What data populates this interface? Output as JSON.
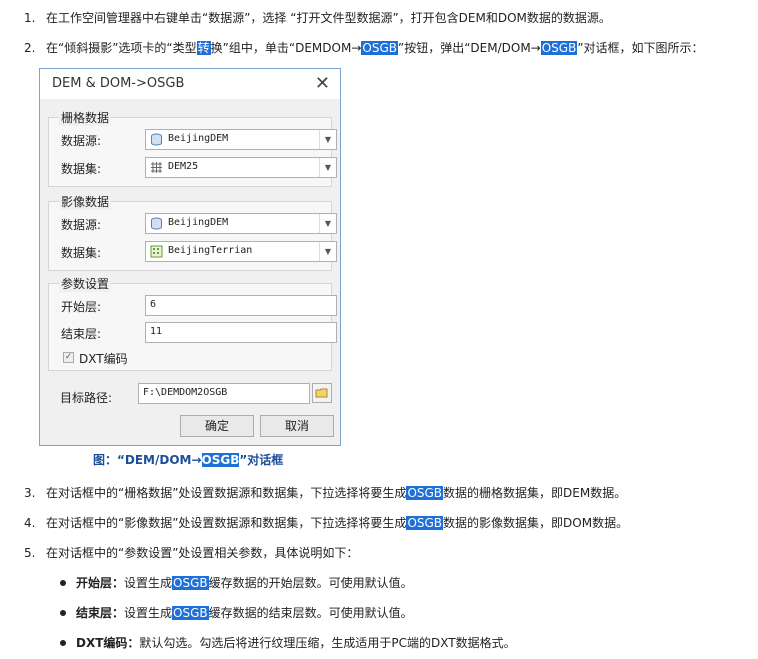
{
  "steps": [
    {
      "num": "1.",
      "text": "在工作空间管理器中右键单击“数据源”，选择 “打开文件型数据源”，打开包含DEM和DOM数据的数据源。"
    },
    {
      "num": "2.",
      "pre": "在“倾斜摄影”选项卡的“类型",
      "hl1": "转",
      "mid": "换”组中，单击“DEMDOM→",
      "hl2": "OSGB",
      "mid2": "”按钮，弹出“DEM/DOM→",
      "hl3": "OSGB",
      "post": "”对话框，如下图所示："
    },
    {
      "num": "3.",
      "pre": "在对话框中的“栅格数据”处设置数据源和数据集，下拉选择将要生成",
      "hl": "OSGB",
      "post": "数据的栅格数据集，即DEM数据。"
    },
    {
      "num": "4.",
      "pre": "在对话框中的“影像数据”处设置数据源和数据集，下拉选择将要生成",
      "hl": "OSGB",
      "post": "数据的影像数据集，即DOM数据。"
    },
    {
      "num": "5.",
      "text": "在对话框中的“参数设置”处设置相关参数，具体说明如下："
    }
  ],
  "dialog": {
    "title": "DEM & DOM->OSGB",
    "close": "✕",
    "raster_group": "栅格数据",
    "image_group": "影像数据",
    "params_group": "参数设置",
    "datasource_label": "数据源:",
    "dataset_label": "数据集:",
    "raster_datasource": "BeijingDEM",
    "raster_dataset": "DEM25",
    "image_datasource": "BeijingDEM",
    "image_dataset": "BeijingTerrian",
    "start_label": "开始层:",
    "start_value": "6",
    "end_label": "结束层:",
    "end_value": "11",
    "dxt_label": "DXT编码",
    "target_label": "目标路径:",
    "target_value": "F:\\DEMDOM2OSGB",
    "ok": "确定",
    "cancel": "取消"
  },
  "caption": {
    "pre": "图：“DEM/DOM→",
    "hl": "OSGB",
    "post": "”对话框"
  },
  "bullets": [
    {
      "term": "开始层：",
      "pre": "设置生成",
      "hl": "OSGB",
      "post": "缓存数据的开始层数。可使用默认值。"
    },
    {
      "term": "结束层：",
      "pre": "设置生成",
      "hl": "OSGB",
      "post": "缓存数据的结束层数。可使用默认值。"
    },
    {
      "term": "DXT编码：",
      "pre": "",
      "hl": "",
      "post": "默认勾选。勾选后将进行纹理压缩，生成适用于PC端的DXT数据格式。"
    }
  ]
}
